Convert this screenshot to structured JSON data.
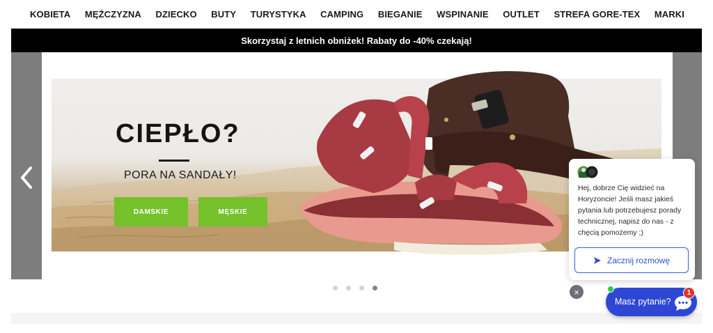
{
  "nav": {
    "items": [
      {
        "label": "KOBIETA"
      },
      {
        "label": "MĘŻCZYZNA"
      },
      {
        "label": "DZIECKO"
      },
      {
        "label": "BUTY"
      },
      {
        "label": "TURYSTYKA"
      },
      {
        "label": "CAMPING"
      },
      {
        "label": "BIEGANIE"
      },
      {
        "label": "WSPINANIE"
      },
      {
        "label": "OUTLET"
      },
      {
        "label": "STREFA GORE-TEX"
      },
      {
        "label": "MARKI"
      }
    ]
  },
  "promo": {
    "text": "Skorzystaj z letnich obniżek! Rabaty do -40% czekają!"
  },
  "slider": {
    "prev_icon": "chevron-left-icon",
    "banner": {
      "headline": "CIEPŁO?",
      "subline": "PORA NA SANDAŁY!",
      "buttons": [
        {
          "label": "DAMSKIE"
        },
        {
          "label": "MĘSKIE"
        }
      ]
    },
    "dots": {
      "count": 4,
      "active_index": 3
    }
  },
  "chat": {
    "message": "Hej, dobrze Cię widzieć na Horyzoncie! Jeśli masz jakieś pytania lub potrzebujesz porady technicznej, napisz do nas - z chęcią pomożemy ;)",
    "start_label": "Zacznij rozmowę",
    "close_symbol": "×",
    "launcher_label": "Masz pytanie?",
    "badge_count": "1"
  },
  "colors": {
    "accent_green": "#75c12c",
    "chat_blue": "#2d47d4",
    "promo_bg": "#000000",
    "badge_red": "#e03131"
  }
}
